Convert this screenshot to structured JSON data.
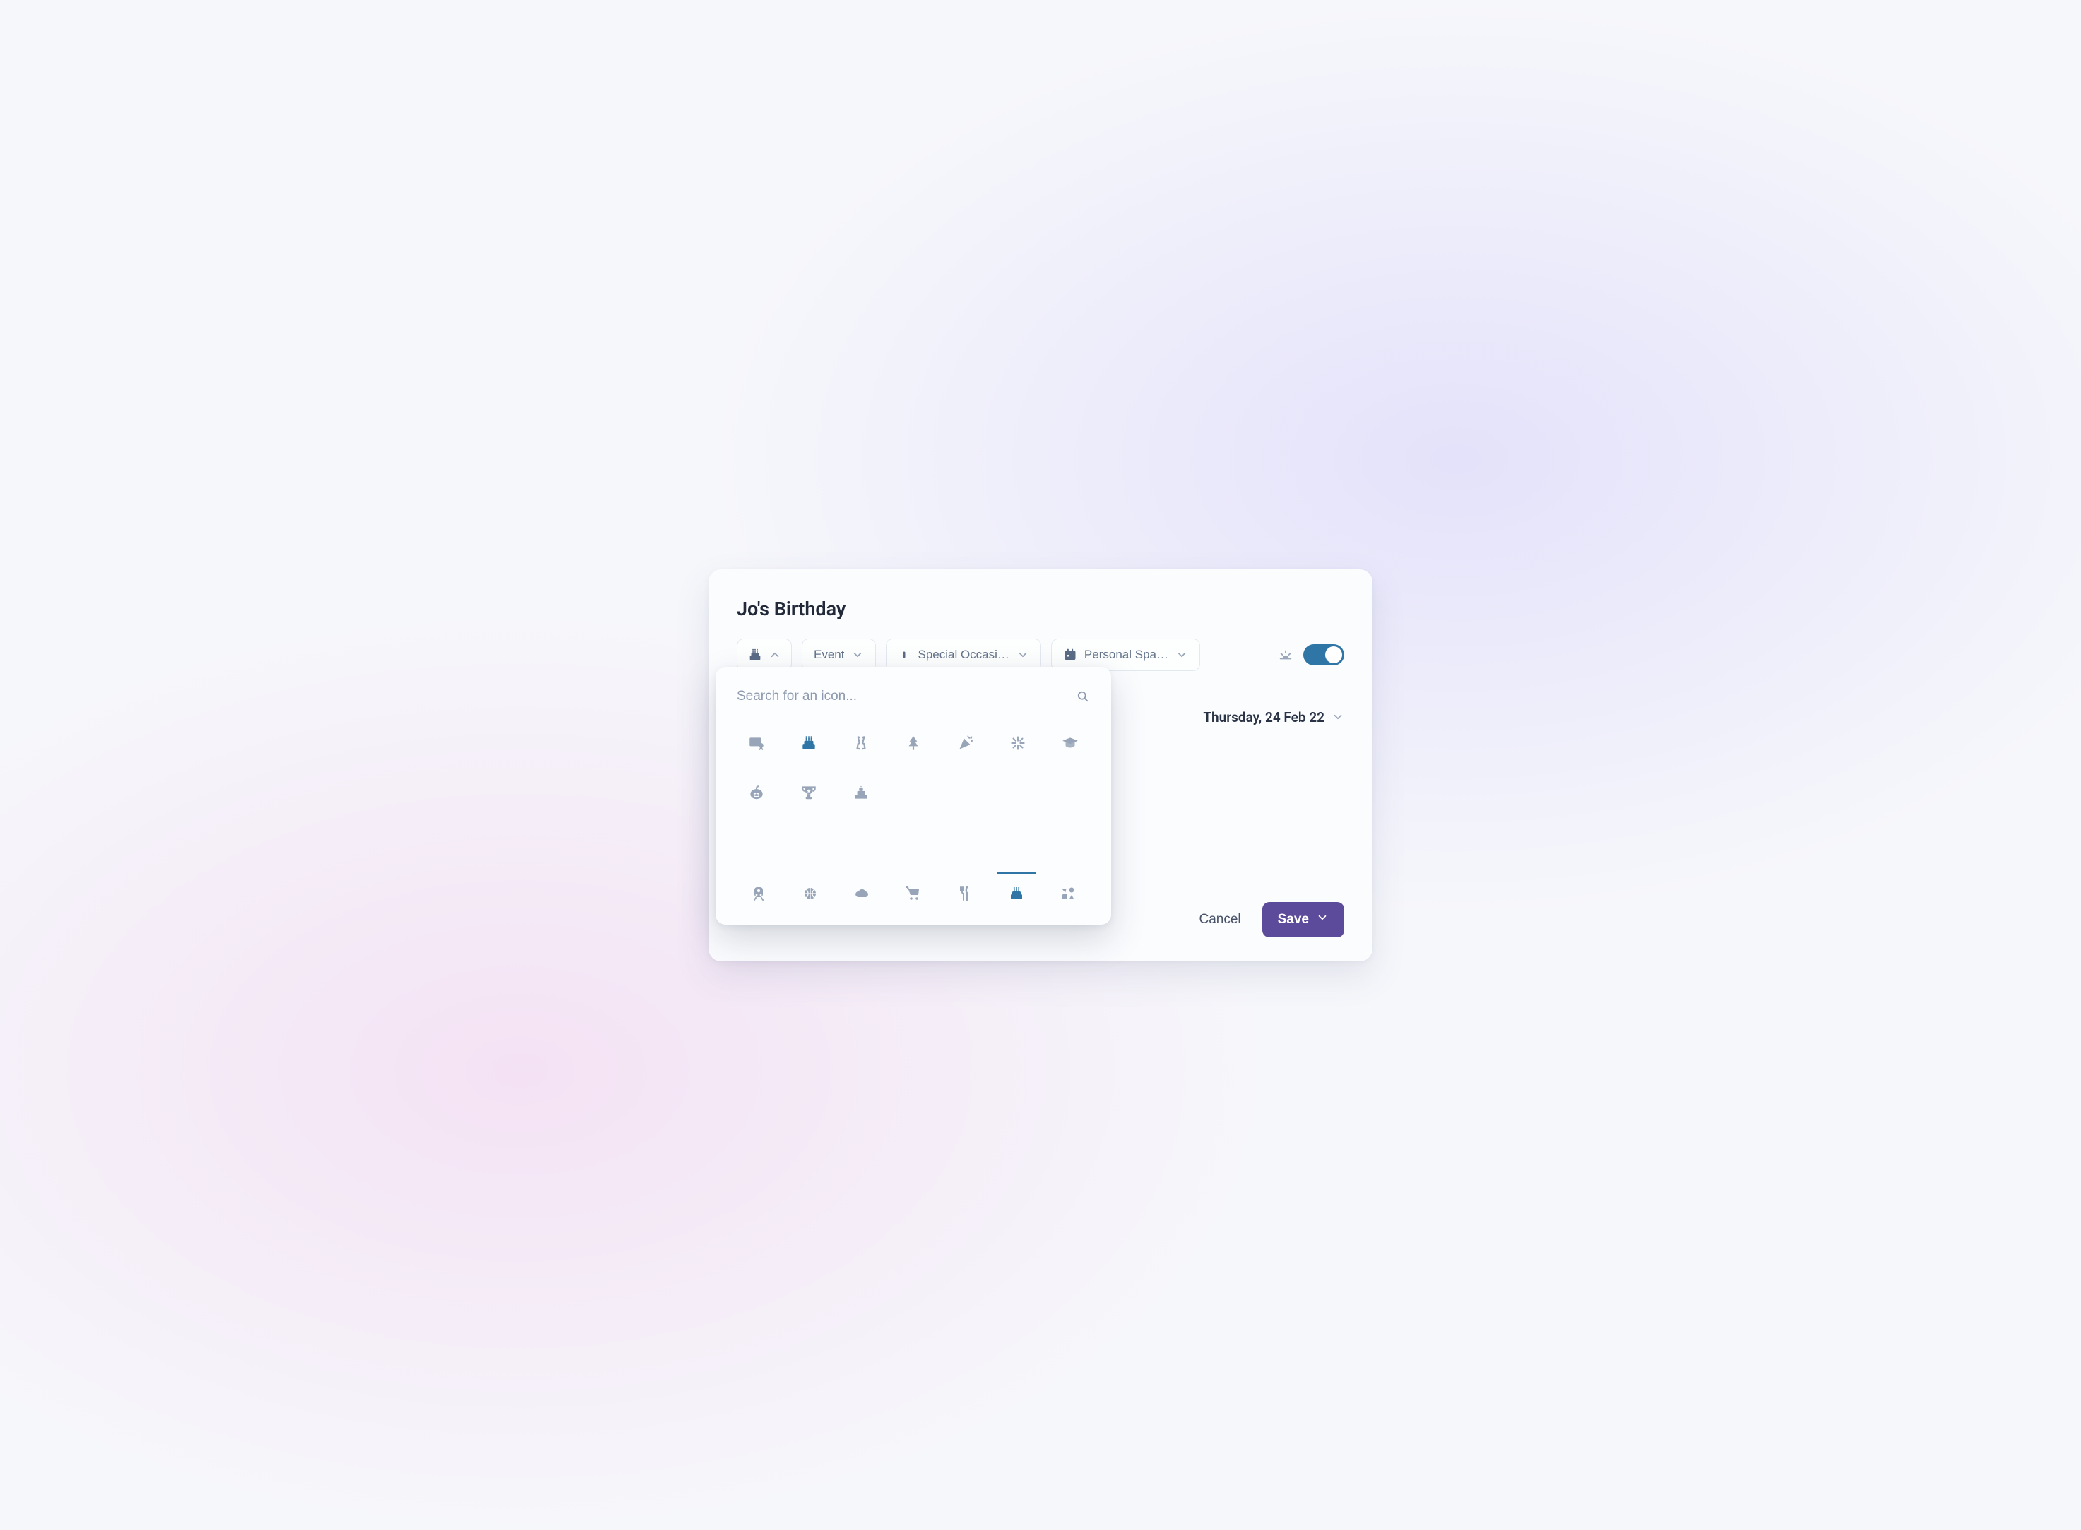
{
  "title": "Jo's Birthday",
  "toolbar": {
    "icon_button": {
      "icon": "birthday-cake-icon",
      "state": "expanded"
    },
    "type_select": {
      "label": "Event"
    },
    "category_select": {
      "label": "Special Occasi…"
    },
    "space_select": {
      "label": "Personal Spa…"
    },
    "all_day_toggle": {
      "icon": "sunrise-icon",
      "on": true
    }
  },
  "icon_picker": {
    "search_placeholder": "Search for an icon...",
    "icons": [
      {
        "name": "certificate-icon",
        "selected": false
      },
      {
        "name": "birthday-cake-icon",
        "selected": true
      },
      {
        "name": "champagne-glasses-icon",
        "selected": false
      },
      {
        "name": "christmas-tree-icon",
        "selected": false
      },
      {
        "name": "party-popper-icon",
        "selected": false
      },
      {
        "name": "fireworks-icon",
        "selected": false
      },
      {
        "name": "graduation-cap-icon",
        "selected": false
      },
      {
        "name": "pumpkin-icon",
        "selected": false
      },
      {
        "name": "trophy-icon",
        "selected": false
      },
      {
        "name": "wedding-cake-icon",
        "selected": false
      }
    ],
    "tabs": [
      {
        "name": "transport-tab",
        "icon": "train-icon",
        "active": false
      },
      {
        "name": "sports-tab",
        "icon": "basketball-icon",
        "active": false
      },
      {
        "name": "weather-tab",
        "icon": "cloud-icon",
        "active": false
      },
      {
        "name": "shopping-tab",
        "icon": "cart-icon",
        "active": false
      },
      {
        "name": "food-tab",
        "icon": "utensils-icon",
        "active": false
      },
      {
        "name": "celebrate-tab",
        "icon": "birthday-cake-icon",
        "active": true
      },
      {
        "name": "shapes-tab",
        "icon": "shapes-icon",
        "active": false
      }
    ]
  },
  "date": {
    "label": "Thursday, 24 Feb 22"
  },
  "footer": {
    "cancel": "Cancel",
    "save": "Save"
  },
  "colors": {
    "accent": "#2f76a6",
    "primary_button": "#5c4a9b",
    "muted": "#98a4b8"
  }
}
